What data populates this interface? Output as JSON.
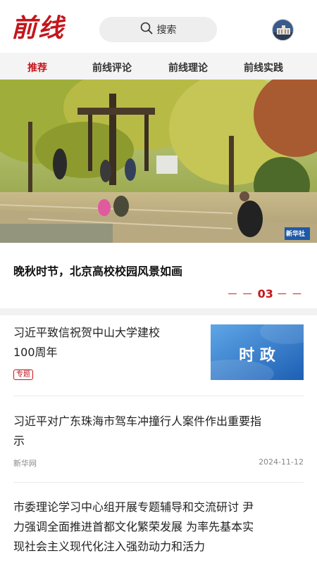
{
  "header": {
    "logo": "前线",
    "search_label": "搜索"
  },
  "tabs": [
    {
      "label": "推荐",
      "active": true
    },
    {
      "label": "前线评论",
      "active": false
    },
    {
      "label": "前线理论",
      "active": false
    },
    {
      "label": "前线实践",
      "active": false
    }
  ],
  "hero": {
    "title": "晚秋时节，北京高校校园风景如画",
    "page": "03",
    "watermark": "新华社"
  },
  "articles": [
    {
      "title_line1": "习近平致信祝贺中山大学建校",
      "title_line2": "100周年",
      "tag": "专题",
      "thumb_text": "时 政"
    },
    {
      "title_line1": "习近平对广东珠海市驾车冲撞行人案件作出重要指",
      "title_line2": "示",
      "source": "新华网",
      "date": "2024-11-12"
    },
    {
      "title_line1": "市委理论学习中心组开展专题辅导和交流研讨 尹",
      "title_line2": "力强调全面推进首都文化繁荣发展 为率先基本实",
      "title_line3": "现社会主义现代化注入强劲动力和活力"
    }
  ],
  "colors": {
    "brand_red": "#c4161c",
    "tab_bg": "#f4f4f4"
  }
}
